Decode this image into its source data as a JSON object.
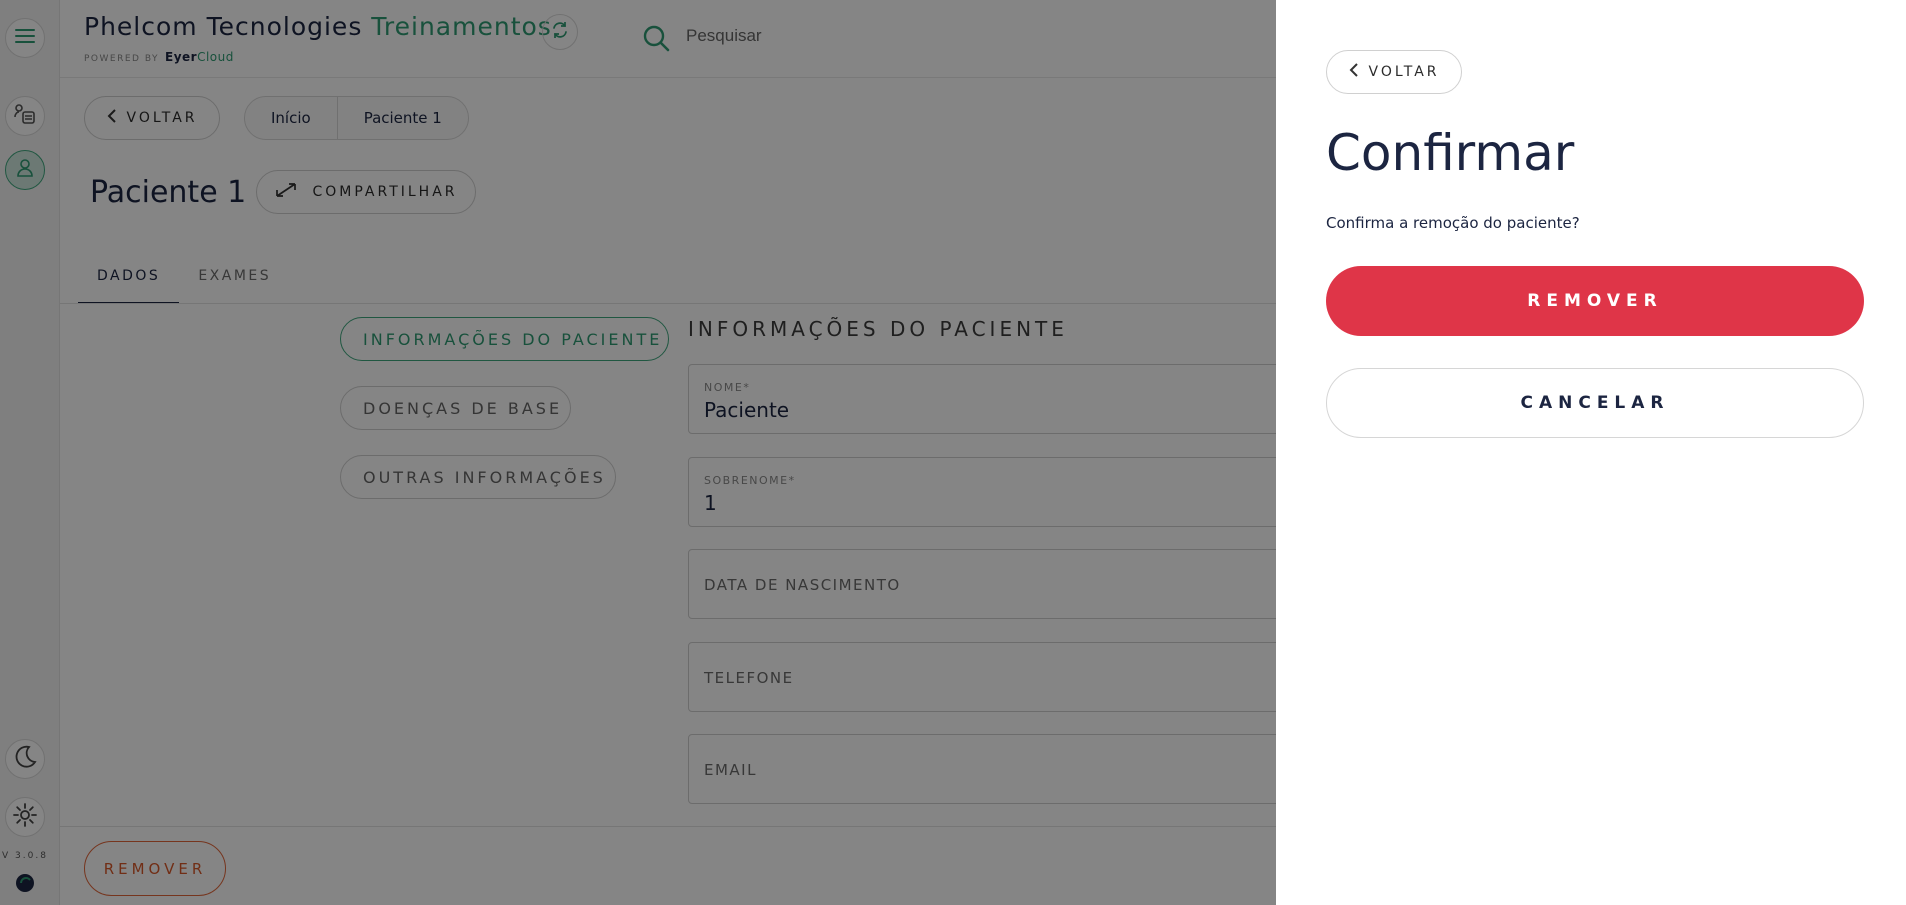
{
  "header": {
    "brand_main": "Phelcom Tecnologies",
    "brand_accent": "Treinamentos",
    "powered_by": "POWERED BY",
    "powered_eyer": "Eyer",
    "powered_cloud": "Cloud",
    "search_placeholder": "Pesquisar"
  },
  "rail": {
    "version": "V 3.0.8",
    "icons": [
      "menu-icon",
      "patients-list-icon",
      "patient-icon",
      "moon-icon",
      "gear-icon",
      "eyer-logo-icon"
    ]
  },
  "subheader": {
    "back_label": "VOLTAR",
    "breadcrumbs": [
      "Início",
      "Paciente 1"
    ]
  },
  "page": {
    "title": "Paciente 1",
    "share_label": "COMPARTILHAR",
    "tabs": [
      {
        "label": "DADOS",
        "active": true
      },
      {
        "label": "EXAMES",
        "active": false
      }
    ],
    "side_sections": [
      {
        "label": "INFORMAÇÕES DO PACIENTE",
        "active": true
      },
      {
        "label": "DOENÇAS DE BASE",
        "active": false
      },
      {
        "label": "OUTRAS INFORMAÇÕES",
        "active": false
      }
    ],
    "section_title": "INFORMAÇÕES DO PACIENTE",
    "fields": [
      {
        "label": "NOME*",
        "value": "Paciente"
      },
      {
        "label": "SOBRENOME*",
        "value": "1"
      },
      {
        "label": "DATA DE NASCIMENTO",
        "value": ""
      },
      {
        "label": "TELEFONE",
        "value": ""
      },
      {
        "label": "EMAIL",
        "value": ""
      }
    ],
    "footer_remove_label": "REMOVER"
  },
  "drawer": {
    "back_label": "VOLTAR",
    "title": "Confirmar",
    "message": "Confirma a remoção do paciente?",
    "remove_label": "REMOVER",
    "cancel_label": "CANCELAR"
  },
  "colors": {
    "accent": "#2f9b73",
    "danger": "#df3548",
    "warning": "#d9582a",
    "text": "#1c2541"
  }
}
